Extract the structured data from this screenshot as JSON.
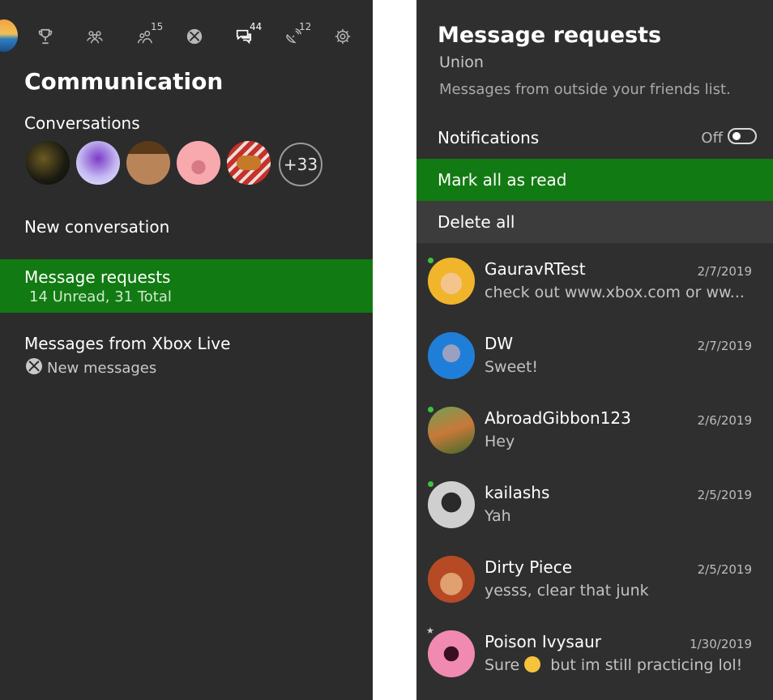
{
  "left": {
    "tabs": [
      {
        "icon": "profile-icon",
        "badge": ""
      },
      {
        "icon": "trophy-icon",
        "badge": ""
      },
      {
        "icon": "party-icon",
        "badge": ""
      },
      {
        "icon": "friends-icon",
        "badge": "15"
      },
      {
        "icon": "xbox-icon",
        "badge": ""
      },
      {
        "icon": "messages-icon",
        "badge": "44"
      },
      {
        "icon": "notifications-icon",
        "badge": "12"
      },
      {
        "icon": "gear-icon",
        "badge": ""
      }
    ],
    "title": "Communication",
    "conversations_label": "Conversations",
    "conversation_avatars": [
      "#0f0f0f",
      "#c8c4f0",
      "#8a5a2a",
      "#f6a6aa",
      "#d33b35"
    ],
    "more_count": "+33",
    "new_conversation": "New conversation",
    "message_requests": {
      "title": "Message requests",
      "subtitle": "14 Unread, 31 Total"
    },
    "xbox_live": {
      "title": "Messages from Xbox Live",
      "subtitle": "New messages"
    }
  },
  "right": {
    "title": "Message requests",
    "subtitle": "Union",
    "description": "Messages from outside your friends list.",
    "notifications_label": "Notifications",
    "notifications_state": "Off",
    "mark_all_read": "Mark all as read",
    "delete_all": "Delete all",
    "messages": [
      {
        "name": "GauravRTest",
        "date": "2/7/2019",
        "text": "check out www.xbox.com or ww...",
        "status": "online",
        "avatar_color": "#f0b52a"
      },
      {
        "name": "DW",
        "date": "2/7/2019",
        "text": "Sweet!",
        "status": "",
        "avatar_color": "#1f7fd8"
      },
      {
        "name": "AbroadGibbon123",
        "date": "2/6/2019",
        "text": "Hey",
        "status": "online",
        "avatar_color": "#5f8a3f"
      },
      {
        "name": "kailashs",
        "date": "2/5/2019",
        "text": "Yah",
        "status": "online",
        "avatar_color": "#d6d6d6"
      },
      {
        "name": "Dirty Piece",
        "date": "2/5/2019",
        "text": "yesss, clear that junk",
        "status": "",
        "avatar_color": "#b64a24"
      },
      {
        "name": "Poison Ivysaur",
        "date": "1/30/2019",
        "text_before": "Sure",
        "text_after": " but im still practicing lol!",
        "status": "favorite",
        "avatar_color": "#e94a8a"
      }
    ]
  },
  "colors": {
    "accent_green": "#127a12",
    "panel_bg": "#2c2c2c",
    "online_dot": "#3ec43e"
  }
}
